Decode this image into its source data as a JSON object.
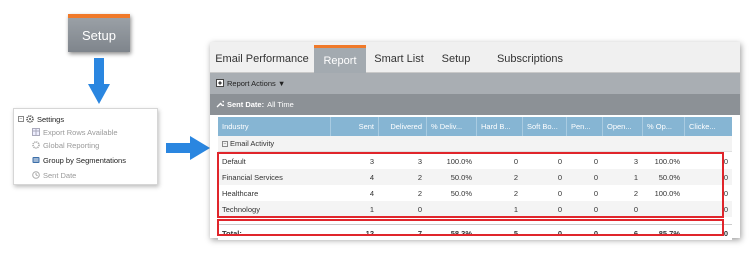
{
  "setup_button": {
    "label": "Setup"
  },
  "tree": {
    "root": "Settings",
    "items": [
      {
        "label": "Export Rows Available",
        "state": "dim"
      },
      {
        "label": "Global Reporting",
        "state": "dim"
      },
      {
        "label": "Group by Segmentations",
        "state": "active"
      },
      {
        "label": "Sent Date",
        "state": "dim"
      }
    ]
  },
  "tabs": [
    "Email Performance",
    "Report",
    "Smart List",
    "Setup",
    "Subscriptions"
  ],
  "active_tab": "Report",
  "toolbar": {
    "report_actions": "Report Actions ▼"
  },
  "filter": {
    "label": "Sent Date:",
    "value": "All Time"
  },
  "columns": [
    "Industry",
    "Sent",
    "Delivered",
    "% Deliv...",
    "Hard B...",
    "Soft Bo...",
    "Pen...",
    "Open...",
    "% Op...",
    "Clicke..."
  ],
  "group_label": "Email Activity",
  "rows": [
    [
      "Default",
      "3",
      "3",
      "100.0%",
      "0",
      "0",
      "0",
      "3",
      "100.0%",
      "0"
    ],
    [
      "Financial Services",
      "4",
      "2",
      "50.0%",
      "2",
      "0",
      "0",
      "1",
      "50.0%",
      "0"
    ],
    [
      "Healthcare",
      "4",
      "2",
      "50.0%",
      "2",
      "0",
      "0",
      "2",
      "100.0%",
      "0"
    ],
    [
      "Technology",
      "1",
      "0",
      "",
      "1",
      "0",
      "0",
      "0",
      "",
      "0"
    ]
  ],
  "total": [
    "Total:",
    "12",
    "7",
    "58.3%",
    "5",
    "0",
    "0",
    "6",
    "85.7%",
    "0"
  ],
  "colors": {
    "accent": "#f07a2a",
    "header_blue": "#86b5d3",
    "highlight_red": "#e0252b",
    "arrow_blue": "#2a86e0"
  }
}
